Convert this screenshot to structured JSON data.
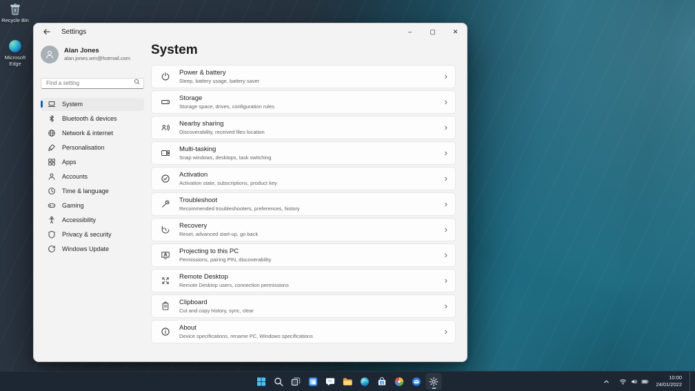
{
  "desktop": {
    "icons": [
      {
        "label": "Recycle Bin",
        "icon": "recycle-bin-icon"
      },
      {
        "label": "Microsoft Edge",
        "icon": "edge-icon"
      }
    ]
  },
  "window": {
    "title": "Settings",
    "controls": {
      "minimize": "–",
      "maximize": "▢",
      "close": "✕"
    },
    "sidebar": {
      "user": {
        "name": "Alan Jones",
        "email": "alan.jones.wm@hotmail.com"
      },
      "search_placeholder": "Find a setting",
      "items": [
        {
          "label": "System",
          "icon": "system-icon",
          "selected": true
        },
        {
          "label": "Bluetooth & devices",
          "icon": "bluetooth-icon",
          "selected": false
        },
        {
          "label": "Network & internet",
          "icon": "network-icon",
          "selected": false
        },
        {
          "label": "Personalisation",
          "icon": "personalisation-icon",
          "selected": false
        },
        {
          "label": "Apps",
          "icon": "apps-icon",
          "selected": false
        },
        {
          "label": "Accounts",
          "icon": "accounts-icon",
          "selected": false
        },
        {
          "label": "Time & language",
          "icon": "time-language-icon",
          "selected": false
        },
        {
          "label": "Gaming",
          "icon": "gaming-icon",
          "selected": false
        },
        {
          "label": "Accessibility",
          "icon": "accessibility-icon",
          "selected": false
        },
        {
          "label": "Privacy & security",
          "icon": "privacy-icon",
          "selected": false
        },
        {
          "label": "Windows Update",
          "icon": "windows-update-icon",
          "selected": false
        }
      ]
    },
    "main": {
      "title": "System",
      "cards": [
        {
          "title": "Power & battery",
          "subtitle": "Sleep, battery usage, battery saver",
          "icon": "power-icon"
        },
        {
          "title": "Storage",
          "subtitle": "Storage space, drives, configuration rules",
          "icon": "storage-icon"
        },
        {
          "title": "Nearby sharing",
          "subtitle": "Discoverability, received files location",
          "icon": "nearby-sharing-icon"
        },
        {
          "title": "Multi-tasking",
          "subtitle": "Snap windows, desktops, task switching",
          "icon": "multitasking-icon"
        },
        {
          "title": "Activation",
          "subtitle": "Activation state, subscriptions, product key",
          "icon": "activation-icon"
        },
        {
          "title": "Troubleshoot",
          "subtitle": "Recommended troubleshooters, preferences, history",
          "icon": "troubleshoot-icon"
        },
        {
          "title": "Recovery",
          "subtitle": "Reset, advanced start-up, go back",
          "icon": "recovery-icon"
        },
        {
          "title": "Projecting to this PC",
          "subtitle": "Permissions, pairing PIN, discoverability",
          "icon": "projecting-icon"
        },
        {
          "title": "Remote Desktop",
          "subtitle": "Remote Desktop users, connection permissions",
          "icon": "remote-desktop-icon"
        },
        {
          "title": "Clipboard",
          "subtitle": "Cut and copy history, sync, clear",
          "icon": "clipboard-icon"
        },
        {
          "title": "About",
          "subtitle": "Device specifications, rename PC, Windows specifications",
          "icon": "about-icon"
        }
      ]
    }
  },
  "taskbar": {
    "icons": [
      {
        "name": "start",
        "open": false
      },
      {
        "name": "search",
        "open": false
      },
      {
        "name": "task-view",
        "open": false
      },
      {
        "name": "widgets",
        "open": false
      },
      {
        "name": "chat",
        "open": false
      },
      {
        "name": "file-explorer",
        "open": false
      },
      {
        "name": "edge",
        "open": false
      },
      {
        "name": "store",
        "open": false
      },
      {
        "name": "photos",
        "open": false
      },
      {
        "name": "mail",
        "open": false
      },
      {
        "name": "settings",
        "open": true
      }
    ],
    "tray": {
      "time": "10:00",
      "date": "24/01/2022"
    }
  },
  "colors": {
    "accent": "#0067c0",
    "taskbar_bg": "#1d2733"
  }
}
